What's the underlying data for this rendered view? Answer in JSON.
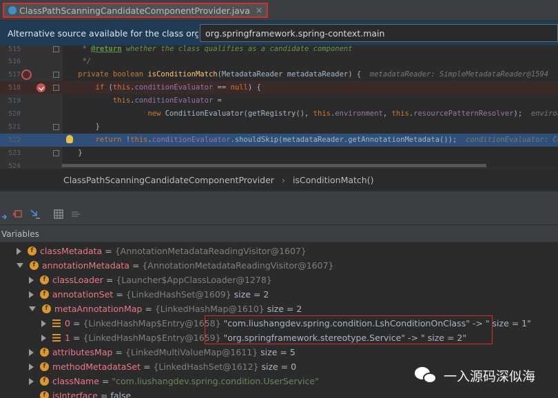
{
  "tab": {
    "title": "ClassPathScanningCandidateComponentProvider.java",
    "close": "×"
  },
  "notice": {
    "text": "Alternative source available for the class org....",
    "selected_source": "org.springframework.spring-context.main"
  },
  "editor": {
    "lines": [
      {
        "num": "515",
        "parts": [
          {
            "t": "     * ",
            "c": "cmt"
          },
          {
            "t": "@return",
            "c": "tag"
          },
          {
            "t": " whether the class qualifies as a candidate component",
            "c": "cmt"
          }
        ]
      },
      {
        "num": "516",
        "parts": [
          {
            "t": "     */",
            "c": "cmt"
          }
        ]
      },
      {
        "num": "517",
        "parts": [
          {
            "t": "    ",
            "c": ""
          },
          {
            "t": "private boolean ",
            "c": "kw"
          },
          {
            "t": "isConditionMatch",
            "c": "fn"
          },
          {
            "t": "(MetadataReader metadataReader) {  ",
            "c": ""
          },
          {
            "t": "metadataReader: SimpleMetadataReader@1594",
            "c": "hint"
          }
        ]
      },
      {
        "num": "518",
        "parts": [
          {
            "t": "        ",
            "c": ""
          },
          {
            "t": "if ",
            "c": "kw"
          },
          {
            "t": "(",
            "c": ""
          },
          {
            "t": "this",
            "c": "kw"
          },
          {
            "t": ".",
            "c": ""
          },
          {
            "t": "conditionEvaluator",
            "c": "fld"
          },
          {
            "t": " == ",
            "c": ""
          },
          {
            "t": "null",
            "c": "kw"
          },
          {
            "t": ") {",
            "c": ""
          }
        ]
      },
      {
        "num": "519",
        "parts": [
          {
            "t": "            ",
            "c": ""
          },
          {
            "t": "this",
            "c": "kw"
          },
          {
            "t": ".",
            "c": ""
          },
          {
            "t": "conditionEvaluator",
            "c": "fld"
          },
          {
            "t": " =",
            "c": ""
          }
        ]
      },
      {
        "num": "520",
        "parts": [
          {
            "t": "                    ",
            "c": ""
          },
          {
            "t": "new ",
            "c": "kw"
          },
          {
            "t": "ConditionEvaluator(getRegistry(), ",
            "c": ""
          },
          {
            "t": "this",
            "c": "kw"
          },
          {
            "t": ".",
            "c": ""
          },
          {
            "t": "environment",
            "c": "fld"
          },
          {
            "t": ", ",
            "c": ""
          },
          {
            "t": "this",
            "c": "kw"
          },
          {
            "t": ".",
            "c": ""
          },
          {
            "t": "resourcePatternResolver",
            "c": "fld"
          },
          {
            "t": ");  ",
            "c": ""
          },
          {
            "t": "environment",
            "c": "hint"
          }
        ]
      },
      {
        "num": "521",
        "parts": [
          {
            "t": "        }",
            "c": ""
          }
        ]
      },
      {
        "num": "522",
        "parts": [
          {
            "t": "        ",
            "c": ""
          },
          {
            "t": "return ",
            "c": "kw"
          },
          {
            "t": "!",
            "c": ""
          },
          {
            "t": "this",
            "c": "kw"
          },
          {
            "t": ".",
            "c": ""
          },
          {
            "t": "conditionEvaluator",
            "c": "fld"
          },
          {
            "t": ".shouldSkip(metadataReader.getAnnotationMetadata());  ",
            "c": ""
          },
          {
            "t": "conditionEvaluator: Conditi",
            "c": "hint"
          }
        ]
      },
      {
        "num": "523",
        "parts": [
          {
            "t": "    }",
            "c": ""
          }
        ]
      },
      {
        "num": "524",
        "parts": []
      }
    ]
  },
  "breadcrumb": {
    "class_name": "ClassPathScanningCandidateComponentProvider",
    "separator": "›",
    "method": "isConditionMatch()"
  },
  "variables": {
    "header": "Variables",
    "rows": [
      {
        "arrow": "r",
        "icon": "f",
        "name": "classMetadata",
        "value": "{AnnotationMetadataReadingVisitor@1607}",
        "extra": ""
      },
      {
        "arrow": "d",
        "icon": "f",
        "name": "annotationMetadata",
        "value": "{AnnotationMetadataReadingVisitor@1607}",
        "extra": ""
      },
      {
        "arrow": "r",
        "icon": "f",
        "name": "classLoader",
        "value": "{Launcher$AppClassLoader@1278}",
        "extra": ""
      },
      {
        "arrow": "r",
        "icon": "f",
        "name": "annotationSet",
        "value": "{LinkedHashSet@1609}",
        "extra": " size = 2"
      },
      {
        "arrow": "d",
        "icon": "f",
        "name": "metaAnnotationMap",
        "value": "{LinkedHashMap@1610}",
        "extra": " size = 2"
      },
      {
        "arrow": "r",
        "icon": "list",
        "name": "0",
        "value": "{LinkedHashMap$Entry@1658}",
        "extra": " \"com.liushangdev.spring.condition.LshConditionOnClass\" -> \" size = 1\""
      },
      {
        "arrow": "r",
        "icon": "list",
        "name": "1",
        "value": "{LinkedHashMap$Entry@1659}",
        "extra": " \"org.springframework.stereotype.Service\" -> \" size = 2\""
      },
      {
        "arrow": "r",
        "icon": "f",
        "name": "attributesMap",
        "value": "{LinkedMultiValueMap@1611}",
        "extra": " size = 5"
      },
      {
        "arrow": "r",
        "icon": "f",
        "name": "methodMetadataSet",
        "value": "{LinkedHashSet@1612}",
        "extra": " size = 0"
      },
      {
        "arrow": "r",
        "icon": "f",
        "name": "className",
        "value": "",
        "extra": "\"com.liushangdev.spring.condition.UserService\""
      },
      {
        "arrow": "n",
        "icon": "f",
        "name": "isInterface",
        "value": "",
        "extra": "false"
      }
    ]
  },
  "watermark": {
    "text": "一入源码深似海"
  },
  "colors": {
    "accent": "#2d4f7a",
    "highlight_box": "#e0292b",
    "notice_bg": "#1f3b55"
  }
}
